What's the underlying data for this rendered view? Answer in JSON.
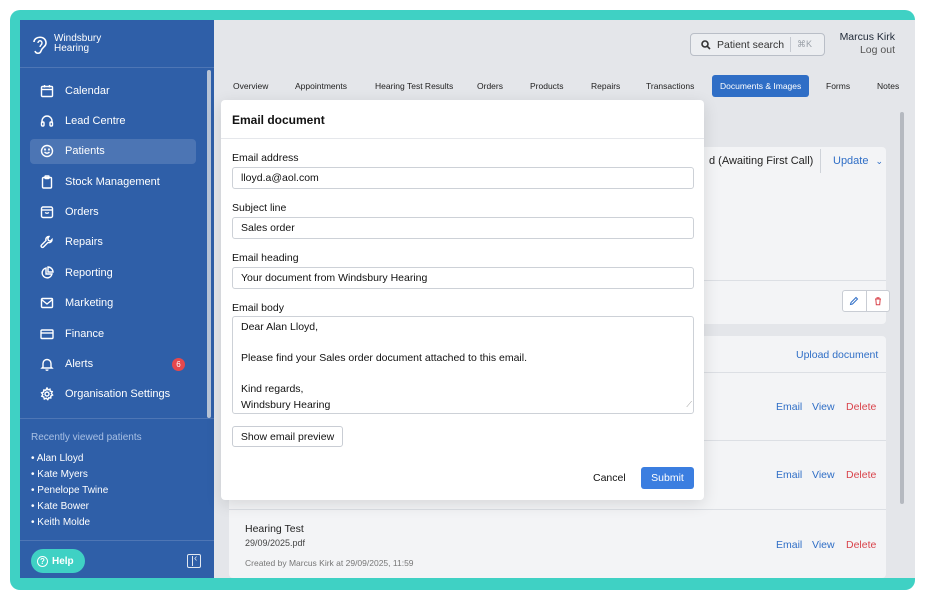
{
  "brand": {
    "line1": "Windsbury",
    "line2": "Hearing"
  },
  "sidebar": {
    "items": [
      {
        "label": "Calendar",
        "icon": "calendar-icon"
      },
      {
        "label": "Lead Centre",
        "icon": "headset-icon"
      },
      {
        "label": "Patients",
        "icon": "smiley-icon",
        "active": true
      },
      {
        "label": "Stock Management",
        "icon": "clipboard-icon"
      },
      {
        "label": "Orders",
        "icon": "box-icon"
      },
      {
        "label": "Repairs",
        "icon": "wrench-icon"
      },
      {
        "label": "Reporting",
        "icon": "pie-chart-icon"
      },
      {
        "label": "Marketing",
        "icon": "envelope-icon"
      },
      {
        "label": "Finance",
        "icon": "card-icon"
      },
      {
        "label": "Alerts",
        "icon": "bell-icon",
        "badge": "6"
      },
      {
        "label": "Organisation Settings",
        "icon": "gear-icon"
      }
    ],
    "recent_title": "Recently viewed patients",
    "recent": [
      "• Alan Lloyd",
      "• Kate Myers",
      "• Penelope Twine",
      "• Kate Bower",
      "• Keith Molde"
    ],
    "help_label": "Help"
  },
  "topbar": {
    "search_label": "Patient search",
    "search_shortcut": "⌘K",
    "user_name": "Marcus Kirk",
    "logout_label": "Log out"
  },
  "tabs": [
    "Overview",
    "Appointments",
    "Hearing Test Results",
    "Orders",
    "Products",
    "Repairs",
    "Transactions",
    "Documents & Images",
    "Forms",
    "Notes"
  ],
  "active_tab": "Documents & Images",
  "background": {
    "status_text": "d (Awaiting First Call)",
    "update_label": "Update",
    "upload_label": "Upload document",
    "doc_actions": {
      "email": "Email",
      "view": "View",
      "delete": "Delete"
    },
    "last_doc": {
      "title": "Hearing Test",
      "file": "29/09/2025.pdf",
      "meta": "Created by Marcus Kirk at 29/09/2025, 11:59"
    }
  },
  "modal": {
    "title": "Email document",
    "email_label": "Email address",
    "email_value": "lloyd.a@aol.com",
    "subject_label": "Subject line",
    "subject_value": "Sales order",
    "heading_label": "Email heading",
    "heading_value": "Your document from Windsbury Hearing",
    "body_label": "Email body",
    "body_lines": [
      "Dear Alan Lloyd,",
      "",
      "Please find your Sales order document attached to this email.",
      "",
      "Kind regards,",
      "Windsbury Hearing"
    ],
    "preview_label": "Show email preview",
    "cancel_label": "Cancel",
    "submit_label": "Submit"
  },
  "colors": {
    "sidebar": "#2f5fa8",
    "accent": "#3fd1c4",
    "primary": "#3b7ee0",
    "danger": "#d9434b"
  }
}
